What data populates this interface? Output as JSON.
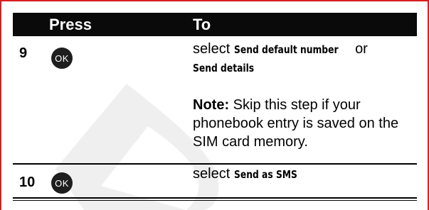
{
  "table": {
    "header": {
      "press": "Press",
      "to": "To"
    },
    "rows": [
      {
        "step": "9",
        "key": "OK",
        "action_prefix": "select",
        "menu_item_1": "Send default number",
        "action_or": "or",
        "menu_item_2": "Send details",
        "note_label": "Note:",
        "note_text": "Skip this step if your phonebook entry is saved on the SIM card memory."
      },
      {
        "step": "10",
        "key": "OK",
        "action_prefix": "select",
        "menu_item_1": "Send as SMS"
      }
    ]
  },
  "colors": {
    "frame": "#d81e1e",
    "header_bg": "#0a0a0a",
    "key_bg": "#1e1e1e",
    "watermark": "#eeeeee"
  },
  "icons": {
    "ok_key": "ok-button-icon",
    "watermark": "draft-d-watermark-icon"
  }
}
